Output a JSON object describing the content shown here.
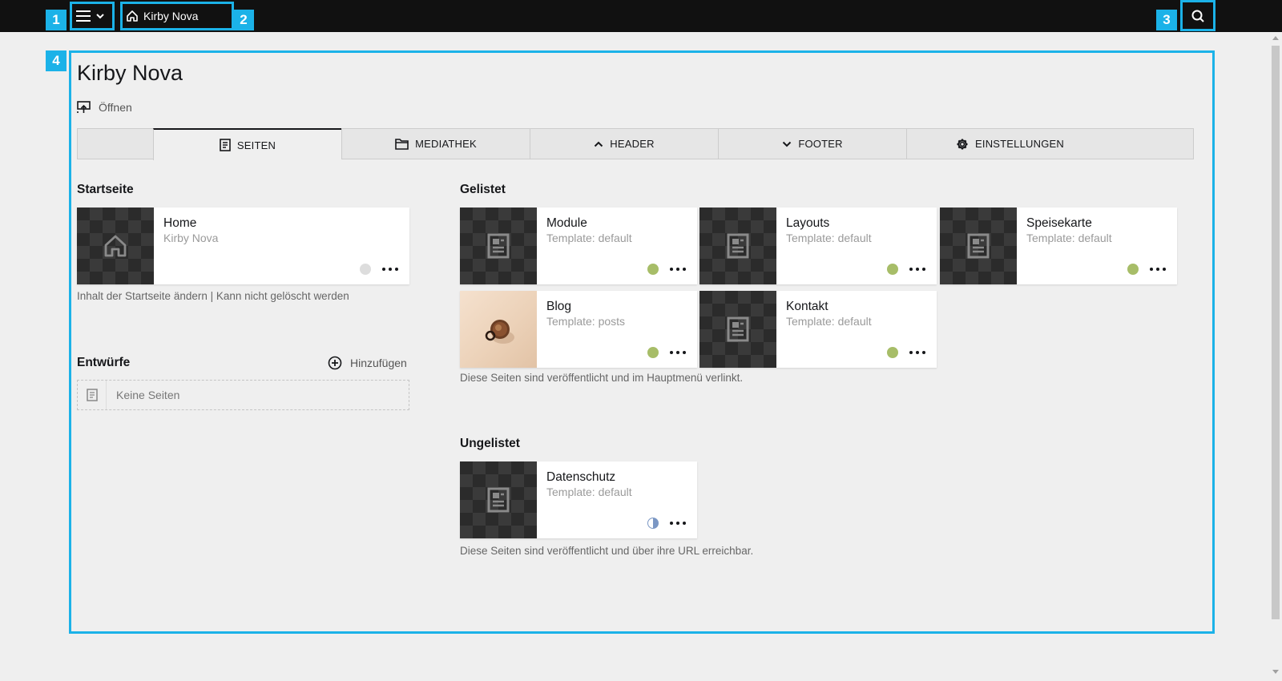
{
  "topbar": {
    "breadcrumb_label": "Kirby Nova"
  },
  "annotations": [
    "1",
    "2",
    "3",
    "4"
  ],
  "page": {
    "title": "Kirby Nova",
    "open_label": "Öffnen"
  },
  "tabs": [
    {
      "label": "",
      "icon": "none"
    },
    {
      "label": "SEITEN",
      "icon": "page-icon",
      "active": true
    },
    {
      "label": "MEDIATHEK",
      "icon": "folder-icon"
    },
    {
      "label": "HEADER",
      "icon": "chevron-up-icon"
    },
    {
      "label": "FOOTER",
      "icon": "chevron-down-icon"
    },
    {
      "label": "EINSTELLUNGEN",
      "icon": "cog-icon"
    }
  ],
  "startseite": {
    "heading": "Startseite",
    "card": {
      "title": "Home",
      "subtitle": "Kirby Nova",
      "status": "unpublished-icon"
    },
    "help": "Inhalt der Startseite ändern | Kann nicht gelöscht werden"
  },
  "entwuerfe": {
    "heading": "Entwürfe",
    "add_label": "Hinzufügen",
    "empty_label": "Keine Seiten"
  },
  "gelistet": {
    "heading": "Gelistet",
    "cards": [
      {
        "title": "Module",
        "subtitle": "Template: default",
        "status": "listed"
      },
      {
        "title": "Layouts",
        "subtitle": "Template: default",
        "status": "listed"
      },
      {
        "title": "Speisekarte",
        "subtitle": "Template: default",
        "status": "listed"
      },
      {
        "title": "Blog",
        "subtitle": "Template: posts",
        "status": "listed"
      },
      {
        "title": "Kontakt",
        "subtitle": "Template: default",
        "status": "listed"
      }
    ],
    "help": "Diese Seiten sind veröffentlicht und im Hauptmenü verlinkt."
  },
  "ungelistet": {
    "heading": "Ungelistet",
    "cards": [
      {
        "title": "Datenschutz",
        "subtitle": "Template: default",
        "status": "unlisted"
      }
    ],
    "help": "Diese Seiten sind veröffentlicht und über ihre URL erreichbar."
  },
  "colors": {
    "topbar": "#111111",
    "background": "#efefef",
    "highlight": "#1bb2e8",
    "status_listed": "#a7bd68",
    "status_unlisted": "#4271ae",
    "status_draft": "#dddddd"
  }
}
